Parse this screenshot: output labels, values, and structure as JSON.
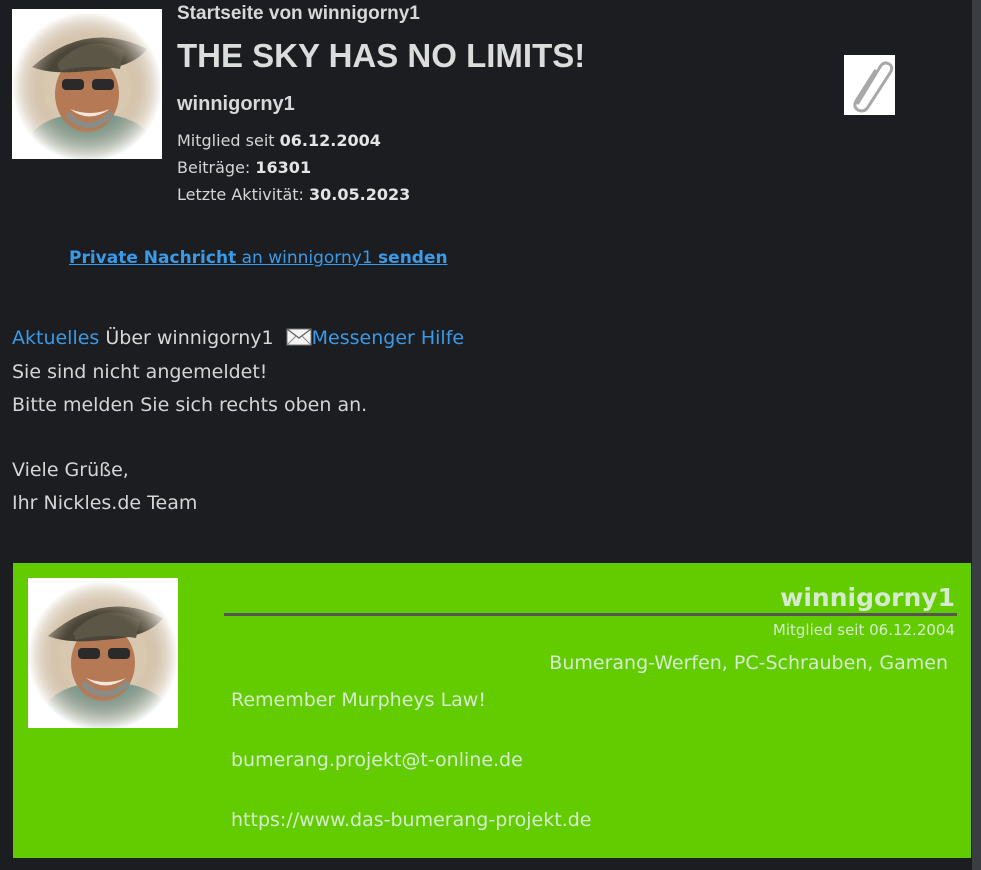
{
  "header": {
    "subtitle": "Startseite von winnigorny1",
    "title": "THE SKY HAS NO LIMITS!",
    "username": "winnigorny1",
    "member_since_label": "Mitglied seit",
    "member_since_value": "06.12.2004",
    "posts_label": "Beiträge:",
    "posts_value": "16301",
    "last_activity_label": "Letzte Aktivität:",
    "last_activity_value": "30.05.2023",
    "clip_icon": "paperclip-icon"
  },
  "pm_link": {
    "part1": "Private Nachricht",
    "part2": " an winnigorny1 ",
    "part3": "senden"
  },
  "nav": {
    "current": "Aktuelles",
    "about": "Über winnigorny1",
    "messenger_icon": "envelope-icon",
    "messenger_help": "Messenger Hilfe"
  },
  "message": {
    "line1": "Sie sind nicht angemeldet!",
    "line2": "Bitte melden Sie sich rechts oben an.",
    "line3": "Viele Grüße,",
    "line4": "Ihr Nickles.de Team"
  },
  "card": {
    "username": "winnigorny1",
    "member_since": "Mitglied seit 06.12.2004",
    "hobbies": "Bumerang-Werfen, PC-Schrauben, Gamen",
    "motto": "Remember Murpheys Law!",
    "email": "bumerang.projekt@t-online.de",
    "website": "https://www.das-bumerang-projekt.de"
  },
  "colors": {
    "background": "#1b1d21",
    "link": "#3b9ae8",
    "card": "#63cc00"
  }
}
